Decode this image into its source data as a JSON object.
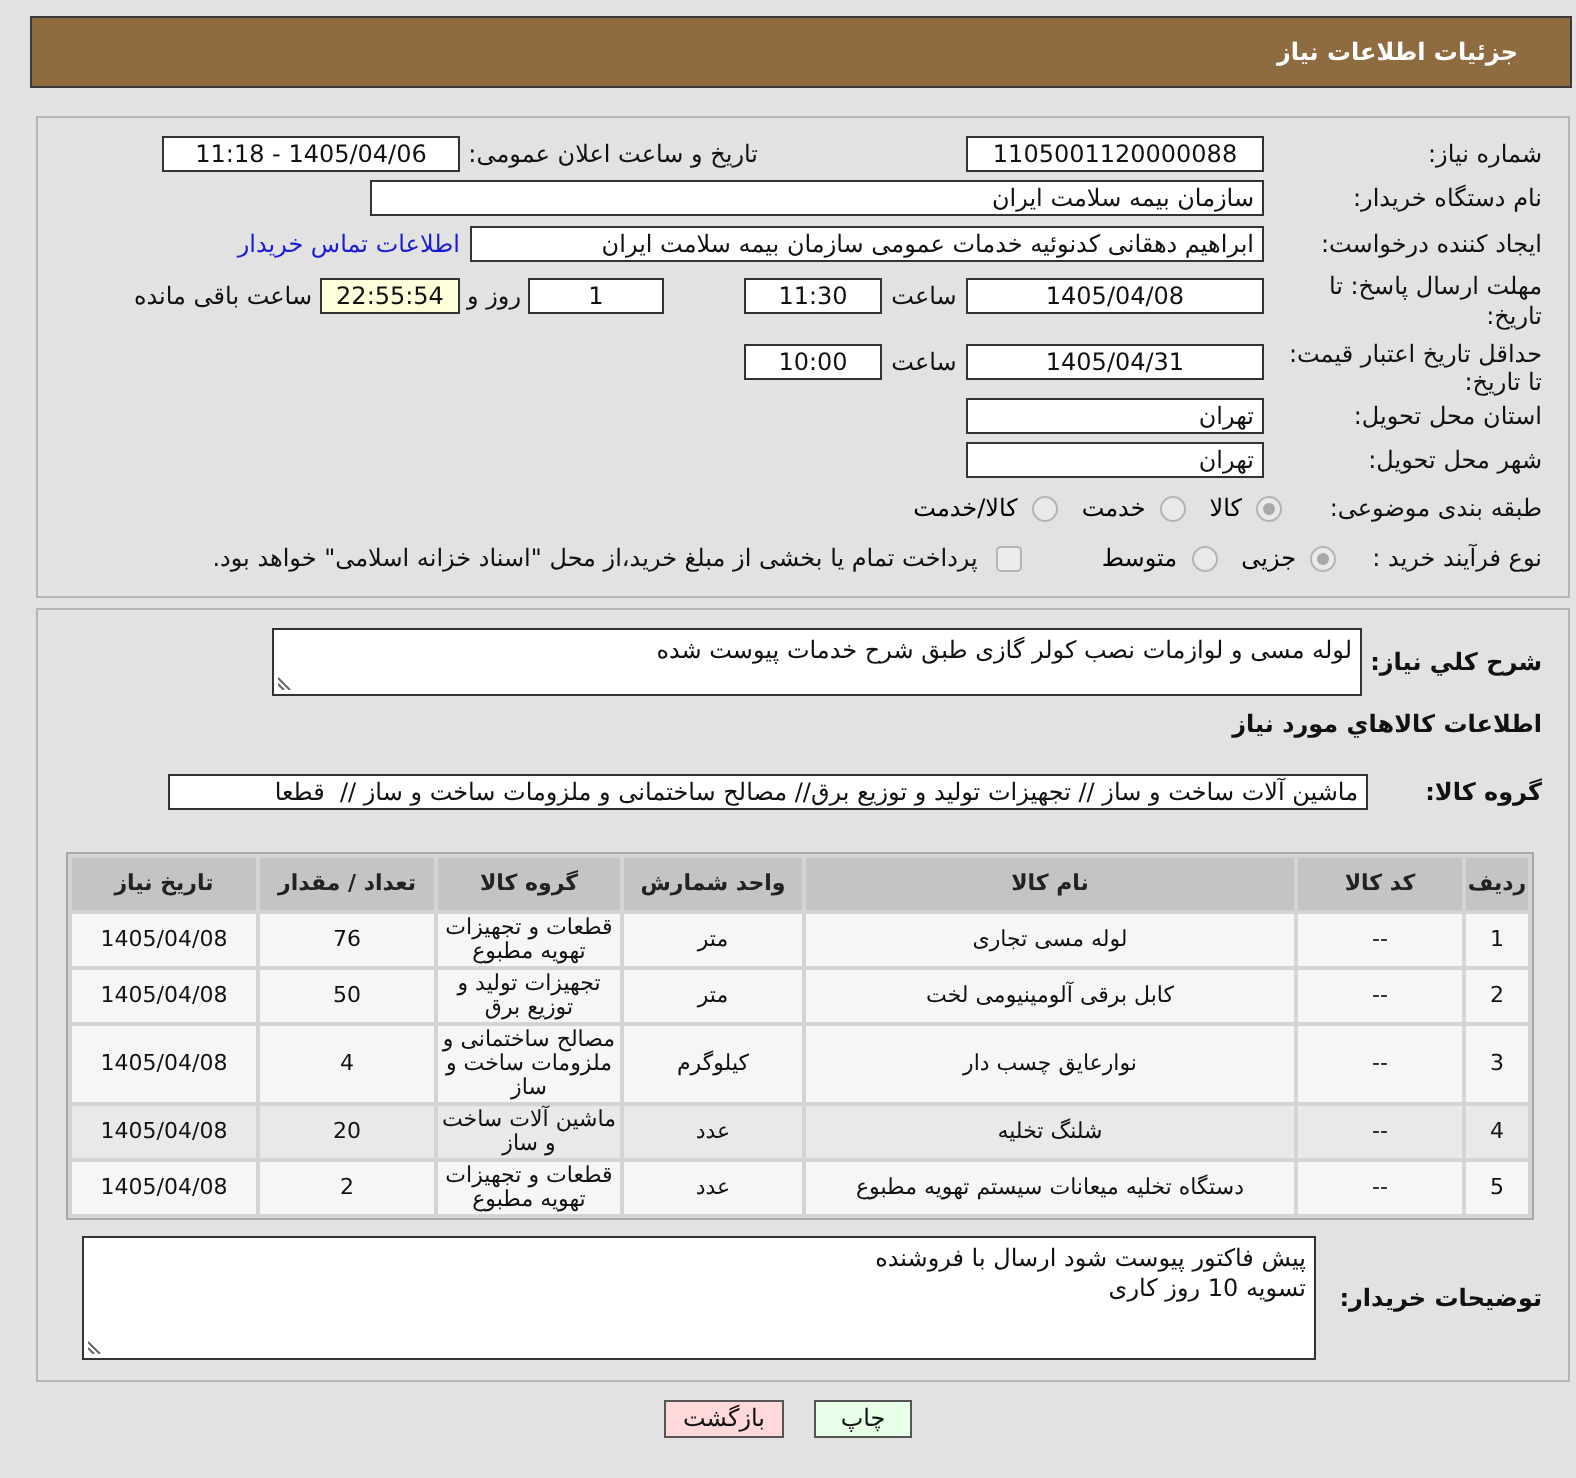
{
  "header": {
    "title": "جزئیات اطلاعات نیاز"
  },
  "need_number": {
    "label": "شماره نیاز:",
    "value": "1105001120000088"
  },
  "announce_datetime": {
    "label": "تاریخ و ساعت اعلان عمومی:",
    "value": "1405/04/06 - 11:18"
  },
  "buyer_org": {
    "label": "نام دستگاه خریدار:",
    "value": "سازمان بیمه سلامت ایران"
  },
  "requester": {
    "label": "ایجاد کننده درخواست:",
    "value": "ابراهیم دهقانی کدنوئیه خدمات عمومی سازمان بیمه سلامت ایران",
    "contact_link": "اطلاعات تماس خریدار"
  },
  "response_deadline": {
    "label": "مهلت ارسال پاسخ: تا تاریخ:",
    "date": "1405/04/08",
    "time_label": "ساعت",
    "time": "11:30",
    "days": "1",
    "days_label": "روز و",
    "remaining": "22:55:54",
    "remaining_label": "ساعت باقی مانده"
  },
  "price_validity": {
    "label": "حداقل تاریخ اعتبار قیمت: تا تاریخ:",
    "date": "1405/04/31",
    "time_label": "ساعت",
    "time": "10:00"
  },
  "delivery_province": {
    "label": "استان محل تحویل:",
    "value": "تهران"
  },
  "delivery_city": {
    "label": "شهر محل تحویل:",
    "value": "تهران"
  },
  "subject_category": {
    "label": "طبقه بندی موضوعی:",
    "disabled": true,
    "options": [
      {
        "label": "کالا",
        "selected": true
      },
      {
        "label": "خدمت",
        "selected": false
      },
      {
        "label": "کالا/خدمت",
        "selected": false
      }
    ]
  },
  "purchase_process": {
    "label": "نوع فرآیند خرید :",
    "disabled": true,
    "options": [
      {
        "label": "جزیی",
        "selected": true
      },
      {
        "label": "متوسط",
        "selected": false
      }
    ],
    "treasury_payment": {
      "label": "پرداخت تمام یا بخشی از مبلغ خرید،از محل \"اسناد خزانه اسلامی\" خواهد بود.",
      "checked": false
    }
  },
  "description": {
    "label": "شرح کلي نياز:",
    "value": "لوله مسی و لوازمات نصب کولر گازی طبق شرح خدمات پیوست شده"
  },
  "goods_section": {
    "title": "اطلاعات کالاهاي مورد نياز",
    "group_label": "گروه کالا:",
    "group_value": "ماشین آلات ساخت و ساز // تجهیزات تولید و توزیع برق// مصالح ساختمانی و ملزومات ساخت و ساز //  قطعا"
  },
  "table": {
    "columns": [
      "ردیف",
      "کد کالا",
      "نام کالا",
      "واحد شمارش",
      "گروه کالا",
      "تعداد / مقدار",
      "تاریخ نیاز"
    ],
    "rows": [
      {
        "cells": [
          "1",
          "--",
          "لوله مسی تجاری",
          "متر",
          "قطعات و تجهیزات تهویه مطبوع",
          "76",
          "1405/04/08"
        ],
        "highlighted": false
      },
      {
        "cells": [
          "2",
          "--",
          "کابل برقی آلومینیومی لخت",
          "متر",
          "تجهیزات تولید و توزیع برق",
          "50",
          "1405/04/08"
        ],
        "highlighted": false
      },
      {
        "cells": [
          "3",
          "--",
          "نوارعایق چسب دار",
          "کیلوگرم",
          "مصالح ساختمانی و ملزومات ساخت و ساز",
          "4",
          "1405/04/08"
        ],
        "highlighted": false
      },
      {
        "cells": [
          "4",
          "--",
          "شلنگ تخلیه",
          "عدد",
          "ماشین آلات ساخت و ساز",
          "20",
          "1405/04/08"
        ],
        "highlighted": true
      },
      {
        "cells": [
          "5",
          "--",
          "دستگاه تخلیه میعانات سیستم تهویه مطبوع",
          "عدد",
          "قطعات و تجهیزات تهویه مطبوع",
          "2",
          "1405/04/08"
        ],
        "highlighted": false
      }
    ]
  },
  "buyer_notes": {
    "label": "توضیحات خریدار:",
    "value": "پیش فاکتور پیوست شود ارسال با فروشنده\nتسویه 10 روز کاری"
  },
  "buttons": [
    {
      "label": "چاپ",
      "kind": "print"
    },
    {
      "label": "بازگشت",
      "kind": "back"
    }
  ]
}
